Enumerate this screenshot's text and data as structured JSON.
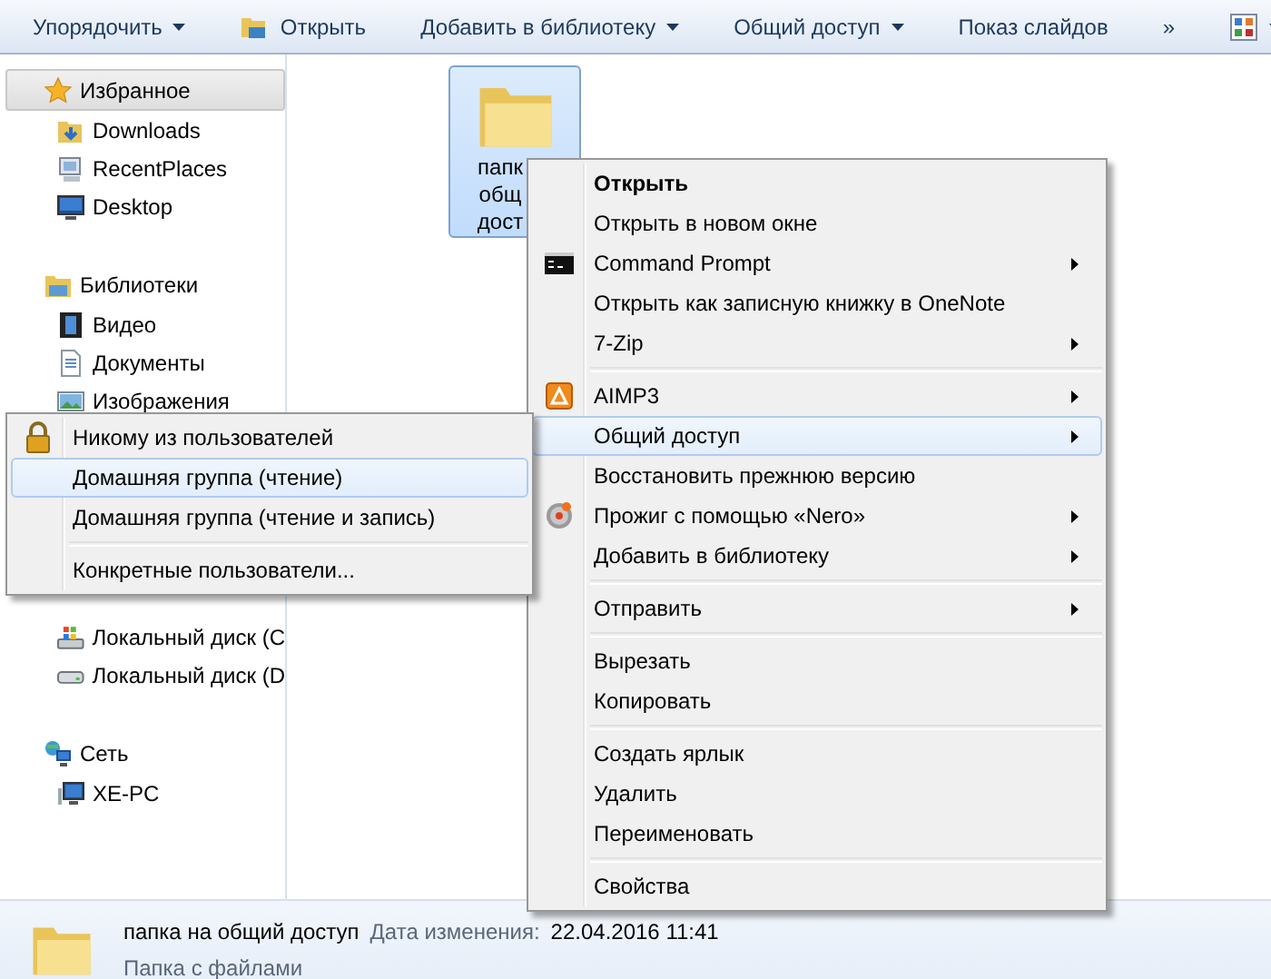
{
  "toolbar": {
    "buttons": [
      {
        "label": "Упорядочить",
        "dropdown": true,
        "kind": "plain"
      },
      {
        "label": "Открыть",
        "dropdown": false,
        "kind": "open"
      },
      {
        "label": "Добавить в библиотеку",
        "dropdown": true,
        "kind": "plain"
      },
      {
        "label": "Общий доступ",
        "dropdown": true,
        "kind": "plain"
      },
      {
        "label": "Показ слайдов",
        "dropdown": false,
        "kind": "plain"
      },
      {
        "label": "»",
        "dropdown": false,
        "kind": "plain"
      },
      {
        "dropdown": true,
        "kind": "views"
      }
    ]
  },
  "sidebar": {
    "groups": [
      {
        "heading": "Избранное",
        "kind": "favorites",
        "selected": true,
        "items": [
          {
            "label": "Downloads",
            "kind": "downloads"
          },
          {
            "label": "RecentPlaces",
            "kind": "recent"
          },
          {
            "label": "Desktop",
            "kind": "desktop"
          }
        ]
      },
      {
        "heading": "Библиотеки",
        "kind": "libraries",
        "selected": false,
        "items": [
          {
            "label": "Видео",
            "kind": "video"
          },
          {
            "label": "Документы",
            "kind": "documents"
          },
          {
            "label": "Изображения",
            "kind": "images"
          }
        ]
      },
      {
        "items": [
          {
            "label": "Локальный диск (C",
            "kind": "system-disk"
          },
          {
            "label": "Локальный диск (D",
            "kind": "disk"
          }
        ]
      },
      {
        "heading": "Сеть",
        "kind": "network",
        "selected": false,
        "items": [
          {
            "label": "XE-PC",
            "kind": "pc"
          }
        ]
      }
    ]
  },
  "folder": {
    "label": "папк\nобщ\nдост",
    "selected": true
  },
  "context_menu": {
    "items": [
      {
        "kind": "plain",
        "label": "Открыть",
        "default": true,
        "submenu": false,
        "selected": false
      },
      {
        "kind": "plain",
        "label": "Открыть в новом окне",
        "default": false,
        "submenu": false,
        "selected": false
      },
      {
        "kind": "console",
        "label": "Command Prompt",
        "default": false,
        "submenu": true,
        "selected": false
      },
      {
        "kind": "plain",
        "label": "Открыть как записную книжку в OneNote",
        "default": false,
        "submenu": false,
        "selected": false
      },
      {
        "kind": "plain",
        "label": "7-Zip",
        "default": false,
        "submenu": true,
        "selected": false
      },
      {
        "kind": "separator"
      },
      {
        "kind": "aimp",
        "label": "AIMP3",
        "default": false,
        "submenu": true,
        "selected": false
      },
      {
        "kind": "plain",
        "label": "Общий доступ",
        "default": false,
        "submenu": true,
        "selected": true
      },
      {
        "kind": "plain",
        "label": "Восстановить прежнюю версию",
        "default": false,
        "submenu": false,
        "selected": false
      },
      {
        "kind": "nero",
        "label": "Прожиг с помощью «Nero»",
        "default": false,
        "submenu": true,
        "selected": false
      },
      {
        "kind": "plain",
        "label": "Добавить в библиотеку",
        "default": false,
        "submenu": true,
        "selected": false
      },
      {
        "kind": "separator"
      },
      {
        "kind": "plain",
        "label": "Отправить",
        "default": false,
        "submenu": true,
        "selected": false
      },
      {
        "kind": "separator"
      },
      {
        "kind": "plain",
        "label": "Вырезать",
        "default": false,
        "submenu": false,
        "selected": false
      },
      {
        "kind": "plain",
        "label": "Копировать",
        "default": false,
        "submenu": false,
        "selected": false
      },
      {
        "kind": "separator"
      },
      {
        "kind": "plain",
        "label": "Создать ярлык",
        "default": false,
        "submenu": false,
        "selected": false
      },
      {
        "kind": "plain",
        "label": "Удалить",
        "default": false,
        "submenu": false,
        "selected": false
      },
      {
        "kind": "plain",
        "label": "Переименовать",
        "default": false,
        "submenu": false,
        "selected": false
      },
      {
        "kind": "separator"
      },
      {
        "kind": "plain",
        "label": "Свойства",
        "default": false,
        "submenu": false,
        "selected": false
      }
    ]
  },
  "share_submenu": {
    "items": [
      {
        "kind": "lock",
        "label": "Никому из пользователей",
        "selected": false
      },
      {
        "kind": "plain",
        "label": "Домашняя группа (чтение)",
        "selected": true
      },
      {
        "kind": "plain",
        "label": "Домашняя группа (чтение и запись)",
        "selected": false
      },
      {
        "kind": "separator"
      },
      {
        "kind": "plain",
        "label": "Конкретные пользователи...",
        "selected": false
      }
    ]
  },
  "details_pane": {
    "name": "папка на общий доступ",
    "date_label": "Дата изменения:",
    "date_value": "22.04.2016 11:41",
    "type": "Папка с файлами"
  }
}
